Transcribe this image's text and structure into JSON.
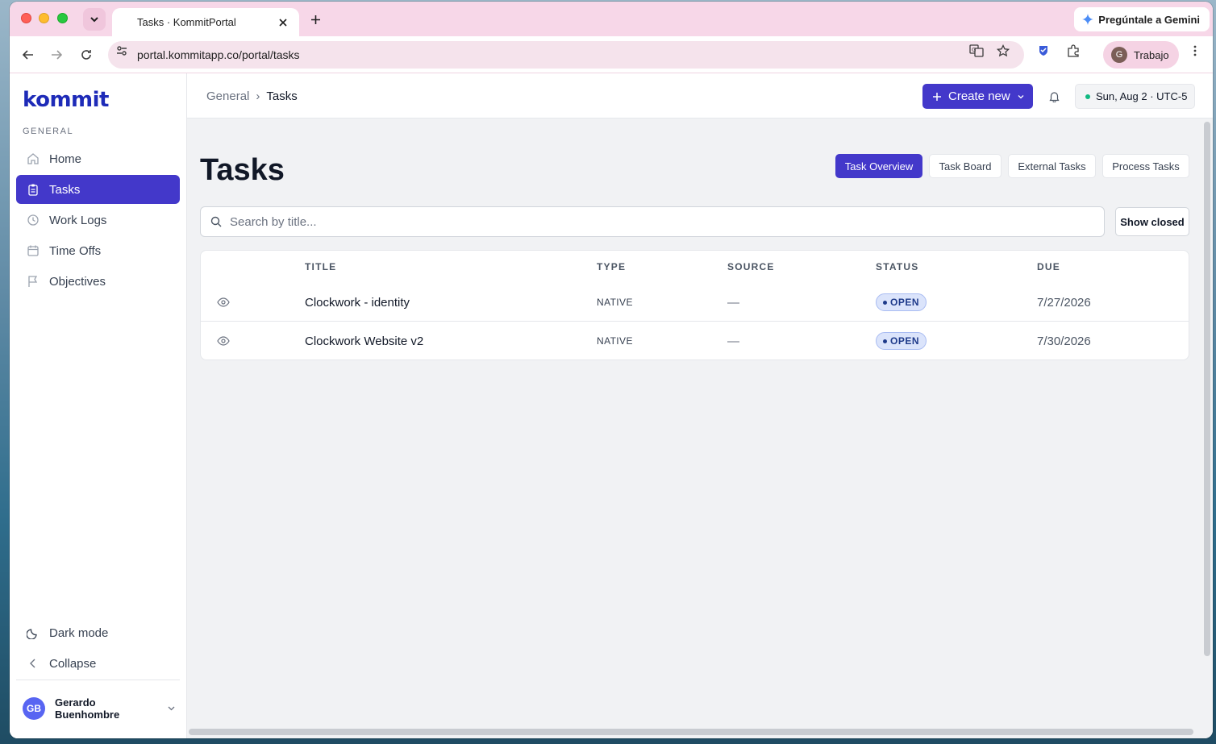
{
  "browser": {
    "tab_title": "Tasks · KommitPortal",
    "gemini_label": "Pregúntale a Gemini",
    "url": "portal.kommitapp.co/portal/tasks",
    "profile_initial": "G",
    "profile_label": "Trabajo"
  },
  "sidebar": {
    "logo": "kommit",
    "section_label": "GENERAL",
    "items": [
      {
        "label": "Home",
        "icon": "home-icon",
        "active": false
      },
      {
        "label": "Tasks",
        "icon": "clipboard-icon",
        "active": true
      },
      {
        "label": "Work Logs",
        "icon": "clock-icon",
        "active": false
      },
      {
        "label": "Time Offs",
        "icon": "calendar-icon",
        "active": false
      },
      {
        "label": "Objectives",
        "icon": "flag-icon",
        "active": false
      }
    ],
    "dark_mode_label": "Dark mode",
    "collapse_label": "Collapse",
    "user": {
      "initials": "GB",
      "name": "Gerardo Buenhombre"
    }
  },
  "header": {
    "breadcrumb": [
      "General",
      "Tasks"
    ],
    "create_label": "Create new",
    "date_label": "Sun, Aug 2 · UTC-5"
  },
  "main": {
    "title": "Tasks",
    "views": [
      "Task Overview",
      "Task Board",
      "External Tasks",
      "Process Tasks"
    ],
    "active_view": "Task Overview",
    "search_placeholder": "Search by title...",
    "show_closed_label": "Show closed",
    "columns": [
      "TITLE",
      "TYPE",
      "SOURCE",
      "STATUS",
      "DUE"
    ],
    "rows": [
      {
        "title": "Clockwork - identity",
        "type": "NATIVE",
        "source": "—",
        "status": "OPEN",
        "due": "7/27/2026"
      },
      {
        "title": "Clockwork Website v2",
        "type": "NATIVE",
        "source": "—",
        "status": "OPEN",
        "due": "7/30/2026"
      }
    ]
  },
  "colors": {
    "accent": "#4338ca",
    "tab_strip": "#f7d7e8",
    "status_open_bg": "#dbe4fb",
    "online_dot": "#10b981"
  }
}
